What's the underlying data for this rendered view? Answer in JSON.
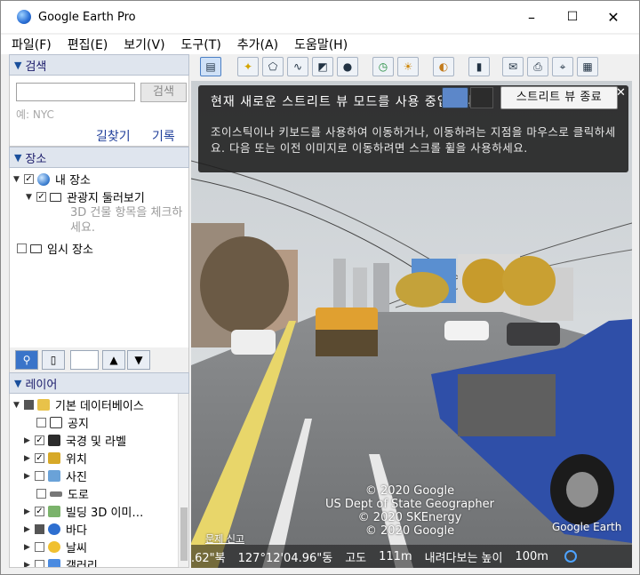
{
  "window": {
    "title": "Google Earth Pro",
    "minimize": "–",
    "maximize": "☐",
    "close": "✕"
  },
  "menu": [
    "파일(F)",
    "편집(E)",
    "보기(V)",
    "도구(T)",
    "추가(A)",
    "도움말(H)"
  ],
  "search": {
    "header": "검색",
    "placeholder": "",
    "button": "검색",
    "hint": "예: NYC",
    "links": [
      "길찾기",
      "기록"
    ]
  },
  "places": {
    "header": "장소",
    "items": [
      {
        "label": "내 장소",
        "checked": true,
        "icon": "earth-icon"
      },
      {
        "label": "관광지 둘러보기",
        "checked": true,
        "icon": "folder-icon"
      },
      {
        "label": "3D 건물 항목을 체크하세요.",
        "icon": ""
      },
      {
        "label": "임시 장소",
        "checked": false,
        "icon": "folder-icon"
      }
    ]
  },
  "layers": {
    "header": "레이어",
    "items": [
      {
        "label": "기본 데이터베이스",
        "checked": "partial",
        "icon": "layers-icon"
      },
      {
        "label": "공지",
        "checked": false,
        "icon": "envelope-icon"
      },
      {
        "label": "국경 및 라벨",
        "checked": true,
        "icon": "flag-icon"
      },
      {
        "label": "위치",
        "checked": true,
        "icon": "pin-icon"
      },
      {
        "label": "사진",
        "checked": false,
        "icon": "photo-icon"
      },
      {
        "label": "도로",
        "checked": false,
        "icon": "road-icon"
      },
      {
        "label": "빌딩 3D 이미…",
        "checked": true,
        "icon": "building-icon"
      },
      {
        "label": "바다",
        "checked": "partial",
        "icon": "ocean-icon"
      },
      {
        "label": "날씨",
        "checked": false,
        "icon": "weather-icon"
      },
      {
        "label": "갤러리",
        "checked": false,
        "icon": "gallery-icon"
      }
    ]
  },
  "streetview": {
    "title": "현재 새로운 스트리트 뷰 모드를 사용 중입니다.",
    "description": "조이스틱이나 키보드를 사용하여 이동하거나, 이동하려는 지점을 마우스로 클릭하세요. 다음 또는 이전 이미지로 이동하려면 스크롤 휠을 사용하세요.",
    "exit_button": "스트리트 뷰 종료",
    "close": "✕"
  },
  "copyright": [
    "© 2020 Google",
    "US Dept of State Geographer",
    "© 2020 SKEnergy",
    "© 2020 Google"
  ],
  "logo": "Google Earth",
  "report": "문제 신고",
  "status": {
    "lat": ".62\"북",
    "lon": "127°12'04.96\"동",
    "elev_label": "고도",
    "elev_value": "111m",
    "eye_label": "내려다보는 높이",
    "eye_value": "100m"
  }
}
